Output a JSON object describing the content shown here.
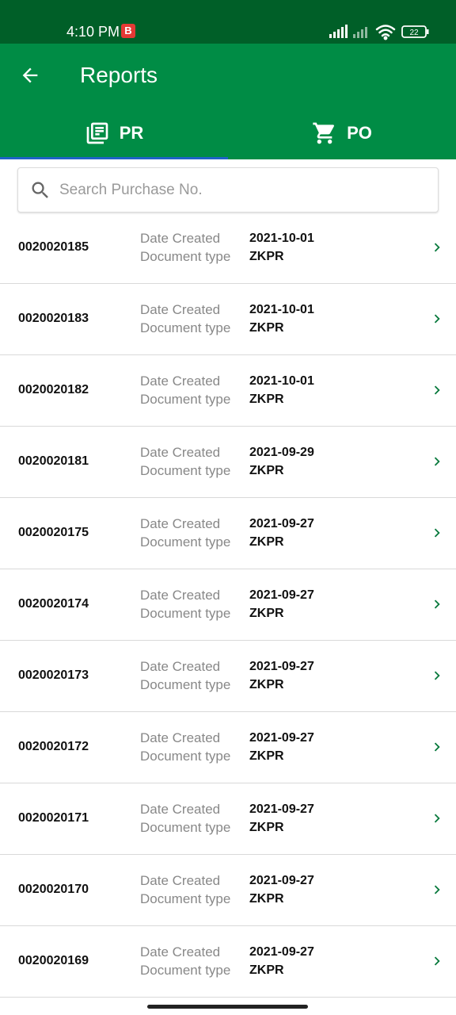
{
  "status": {
    "time": "4:10 PM",
    "badge": "B",
    "battery": "22"
  },
  "header": {
    "title": "Reports"
  },
  "tabs": [
    {
      "label": "PR",
      "icon": "library-books-icon"
    },
    {
      "label": "PO",
      "icon": "cart-icon"
    }
  ],
  "search": {
    "placeholder": "Search Purchase No."
  },
  "colors": {
    "status_bar": "#005f28",
    "app_bar": "#008c45",
    "tab_indicator": "#1e63c7",
    "chevron": "#008c45"
  },
  "rows": [
    {
      "doc": "0020020185",
      "label1": "Date Created",
      "label2": "Document type",
      "date": "2021-10-01",
      "type": "ZKPR"
    },
    {
      "doc": "0020020183",
      "label1": "Date Created",
      "label2": "Document type",
      "date": "2021-10-01",
      "type": "ZKPR"
    },
    {
      "doc": "0020020182",
      "label1": "Date Created",
      "label2": "Document type",
      "date": "2021-10-01",
      "type": "ZKPR"
    },
    {
      "doc": "0020020181",
      "label1": "Date Created",
      "label2": "Document type",
      "date": "2021-09-29",
      "type": "ZKPR"
    },
    {
      "doc": "0020020175",
      "label1": "Date Created",
      "label2": "Document type",
      "date": "2021-09-27",
      "type": "ZKPR"
    },
    {
      "doc": "0020020174",
      "label1": "Date Created",
      "label2": "Document type",
      "date": "2021-09-27",
      "type": "ZKPR"
    },
    {
      "doc": "0020020173",
      "label1": "Date Created",
      "label2": "Document type",
      "date": "2021-09-27",
      "type": "ZKPR"
    },
    {
      "doc": "0020020172",
      "label1": "Date Created",
      "label2": "Document type",
      "date": "2021-09-27",
      "type": "ZKPR"
    },
    {
      "doc": "0020020171",
      "label1": "Date Created",
      "label2": "Document type",
      "date": "2021-09-27",
      "type": "ZKPR"
    },
    {
      "doc": "0020020170",
      "label1": "Date Created",
      "label2": "Document type",
      "date": "2021-09-27",
      "type": "ZKPR"
    },
    {
      "doc": "0020020169",
      "label1": "Date Created",
      "label2": "Document type",
      "date": "2021-09-27",
      "type": "ZKPR"
    }
  ]
}
